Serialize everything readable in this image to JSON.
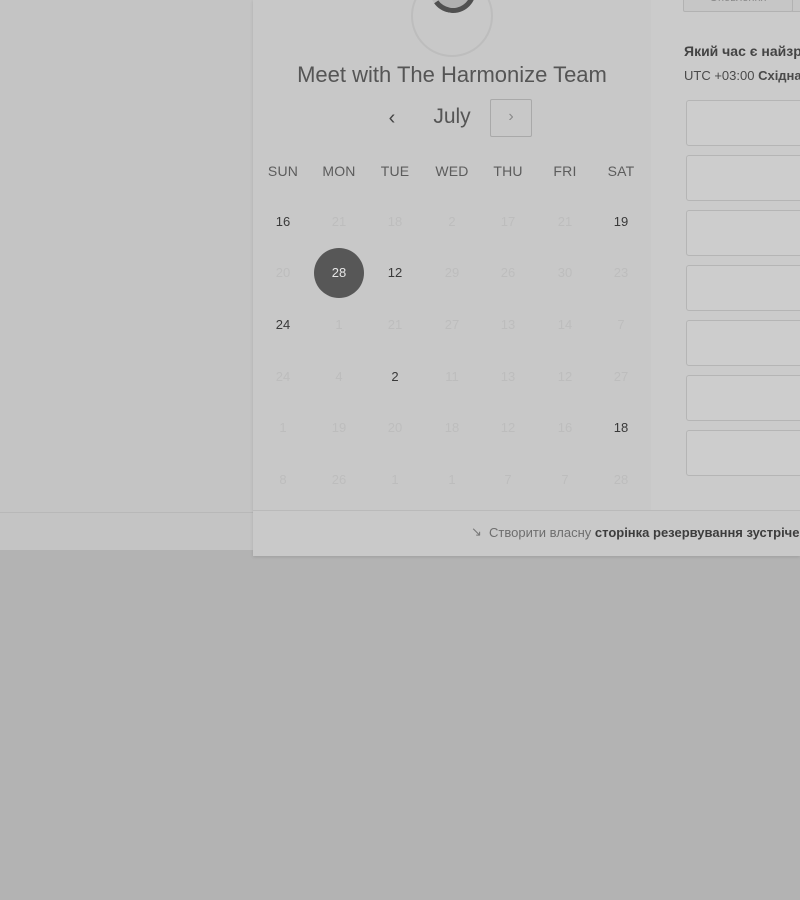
{
  "header": {
    "logo_icon": "dots-spinner-icon",
    "logo_dots": "•••",
    "title": "Meet with The Harmonize Team"
  },
  "calendar": {
    "month": "July",
    "prev_label": "‹",
    "next_label": "›",
    "weekdays": [
      "SUN",
      "MON",
      "TUE",
      "WED",
      "THU",
      "FRI",
      "SAT"
    ],
    "weeks": [
      [
        {
          "t": "16",
          "s": "on"
        },
        {
          "t": "21",
          "s": "off"
        },
        {
          "t": "18",
          "s": "off"
        },
        {
          "t": "2",
          "s": "off"
        },
        {
          "t": "17",
          "s": "off"
        },
        {
          "t": "21",
          "s": "off"
        },
        {
          "t": "19",
          "s": "on"
        }
      ],
      [
        {
          "t": "20",
          "s": "off"
        },
        {
          "t": "28",
          "s": "sel"
        },
        {
          "t": "12",
          "s": "on"
        },
        {
          "t": "29",
          "s": "off"
        },
        {
          "t": "26",
          "s": "off"
        },
        {
          "t": "30",
          "s": "off"
        },
        {
          "t": "23",
          "s": "off"
        }
      ],
      [
        {
          "t": "24",
          "s": "on"
        },
        {
          "t": "1",
          "s": "off"
        },
        {
          "t": "21",
          "s": "off"
        },
        {
          "t": "27",
          "s": "off"
        },
        {
          "t": "13",
          "s": "off"
        },
        {
          "t": "14",
          "s": "off"
        },
        {
          "t": "7",
          "s": "off"
        }
      ],
      [
        {
          "t": "24",
          "s": "off"
        },
        {
          "t": "4",
          "s": "off"
        },
        {
          "t": "2",
          "s": "on"
        },
        {
          "t": "11",
          "s": "off"
        },
        {
          "t": "13",
          "s": "off"
        },
        {
          "t": "12",
          "s": "off"
        },
        {
          "t": "27",
          "s": "off"
        }
      ],
      [
        {
          "t": "1",
          "s": "off"
        },
        {
          "t": "19",
          "s": "off"
        },
        {
          "t": "20",
          "s": "off"
        },
        {
          "t": "18",
          "s": "off"
        },
        {
          "t": "12",
          "s": "off"
        },
        {
          "t": "16",
          "s": "off"
        },
        {
          "t": "18",
          "s": "on"
        }
      ],
      [
        {
          "t": "8",
          "s": "off"
        },
        {
          "t": "26",
          "s": "off"
        },
        {
          "t": "1",
          "s": "off"
        },
        {
          "t": "1",
          "s": "off"
        },
        {
          "t": "7",
          "s": "off"
        },
        {
          "t": "7",
          "s": "off"
        },
        {
          "t": "28",
          "s": "off"
        }
      ]
    ]
  },
  "times": {
    "top_button": "Оновлення",
    "question": "Який час є найзручнішим?",
    "timezone_prefix": "UTC +03:00",
    "timezone_name": "Східна Європа",
    "slot_count_visible": 7
  },
  "footer": {
    "icon": "pointer-arrow-icon",
    "icon_glyph": "↘",
    "text": "Створити власну",
    "link": "сторінка резервування зустрічей"
  },
  "colors": {
    "overlay": "#b3b3b3",
    "selected_day": "#575757"
  }
}
